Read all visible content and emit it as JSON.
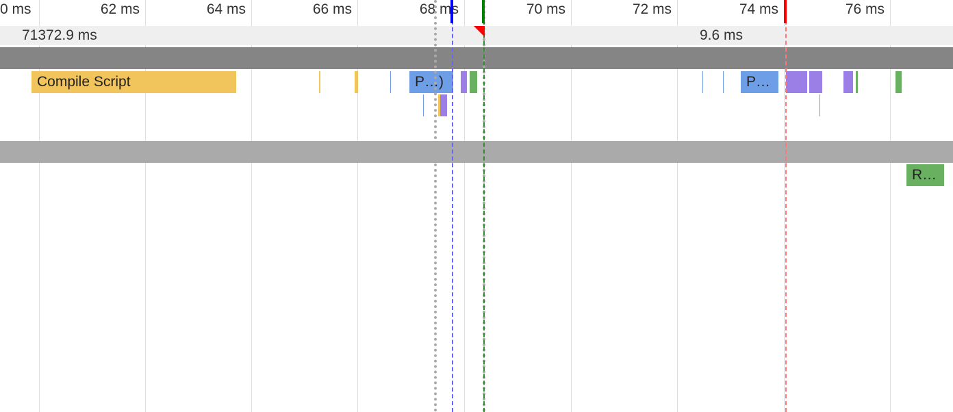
{
  "ruler": {
    "ticks": [
      "0 ms",
      "62 ms",
      "64 ms",
      "66 ms",
      "68 ms",
      "70 ms",
      "72 ms",
      "74 ms",
      "76 ms"
    ]
  },
  "frames": {
    "items": [
      "71372.9 ms",
      "9.6 ms"
    ]
  },
  "main_track": {
    "events": [
      {
        "label": "Compile Script",
        "category": "scripting",
        "depth": 0
      },
      {
        "label": "",
        "category": "scripting",
        "depth": 0
      },
      {
        "label": "",
        "category": "scripting",
        "depth": 0
      },
      {
        "label": "",
        "category": "loading",
        "depth": 0
      },
      {
        "label": "P…)",
        "category": "loading",
        "depth": 0
      },
      {
        "label": "",
        "category": "rendering",
        "depth": 0
      },
      {
        "label": "",
        "category": "painting",
        "depth": 0
      },
      {
        "label": "",
        "category": "loading",
        "depth": 0
      },
      {
        "label": "",
        "category": "loading",
        "depth": 0
      },
      {
        "label": "P…",
        "category": "loading",
        "depth": 0
      },
      {
        "label": "",
        "category": "rendering",
        "depth": 0
      },
      {
        "label": "",
        "category": "rendering",
        "depth": 0
      },
      {
        "label": "",
        "category": "rendering",
        "depth": 0
      },
      {
        "label": "",
        "category": "painting",
        "depth": 0
      },
      {
        "label": "",
        "category": "painting",
        "depth": 0
      },
      {
        "label": "",
        "category": "loading",
        "depth": 1
      },
      {
        "label": "",
        "category": "scripting",
        "depth": 1
      },
      {
        "label": "",
        "category": "rendering",
        "depth": 1
      },
      {
        "label": "",
        "category": "rendering",
        "depth": 1
      }
    ]
  },
  "secondary_track": {
    "events": [
      {
        "label": "R…",
        "category": "painting",
        "depth": 0
      }
    ]
  },
  "markers": [
    {
      "name": "first-paint",
      "color": "#0000ff"
    },
    {
      "name": "first-contentful-paint",
      "color": "#008000"
    },
    {
      "name": "load",
      "color": "#ff0000"
    }
  ],
  "colors": {
    "scripting": "#f2c55c",
    "loading": "#6e9ee6",
    "rendering": "#9b7fe6",
    "painting": "#6ab061",
    "group_header_dark": "#858585",
    "group_header_light": "#aaaaaa",
    "frames_row": "#efefef"
  }
}
